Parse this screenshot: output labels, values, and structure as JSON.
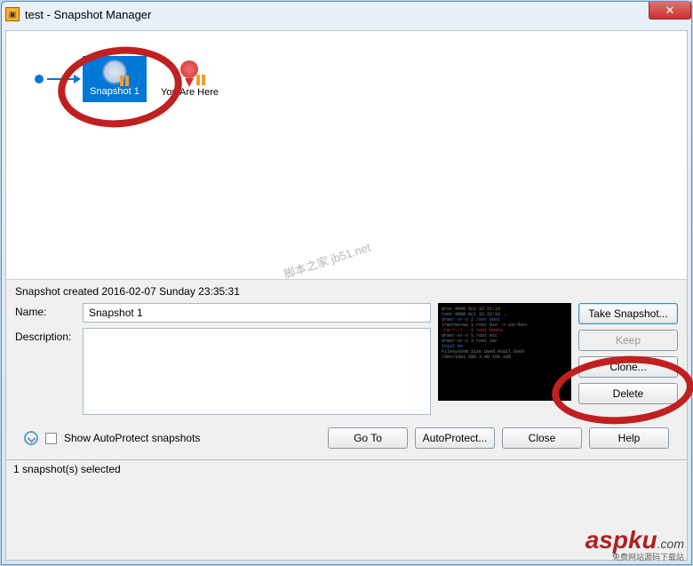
{
  "window": {
    "title": "test - Snapshot Manager",
    "close_icon": "✕"
  },
  "tree": {
    "snapshot_node_label": "Snapshot 1",
    "here_label": "You Are Here"
  },
  "watermark": "脚本之家 jb51.net",
  "details": {
    "created_line": "Snapshot created 2016-02-07 Sunday 23:35:31",
    "name_label": "Name:",
    "name_value": "Snapshot 1",
    "desc_label": "Description:",
    "desc_value": ""
  },
  "buttons": {
    "take_snapshot": "Take Snapshot...",
    "keep": "Keep",
    "clone": "Clone...",
    "delete": "Delete",
    "goto": "Go To",
    "autoprotect": "AutoProtect...",
    "close": "Close",
    "help": "Help"
  },
  "footer": {
    "show_autoprotect": "Show AutoProtect snapshots"
  },
  "statusbar": "1 snapshot(s) selected",
  "branding": {
    "main": "aspku",
    "suffix": ".com",
    "sub": "免费网站源码下载站"
  }
}
